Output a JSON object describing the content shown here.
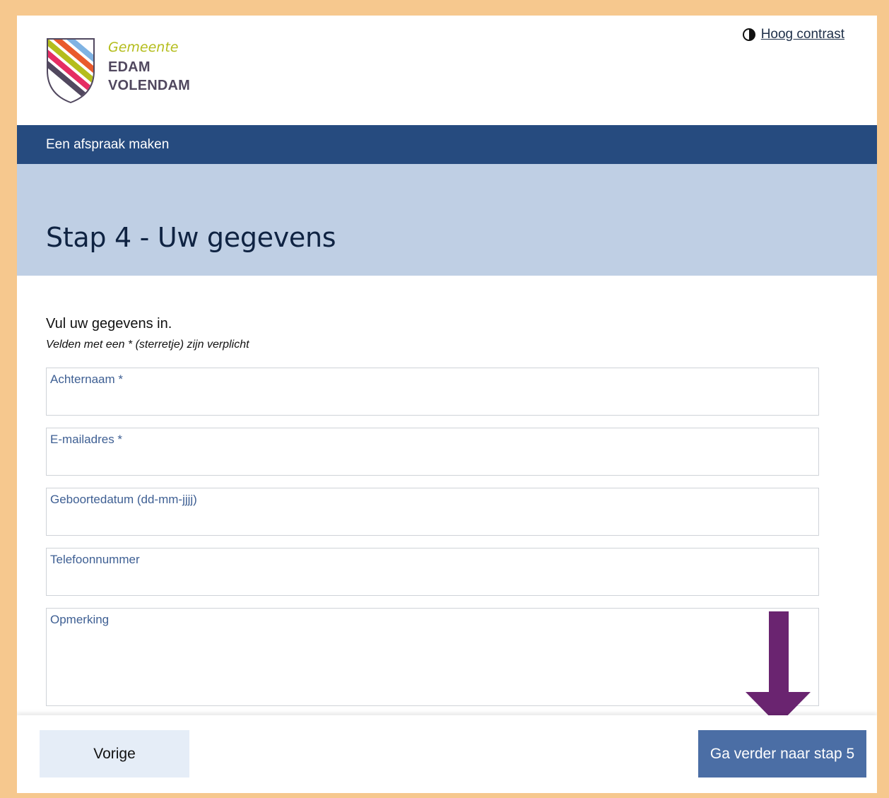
{
  "header": {
    "logo": {
      "small": "Gemeente",
      "line1": "EDAM",
      "line2": "VOLENDAM",
      "icon": "edam-volendam-shield-icon"
    },
    "contrast_link": "Hoog contrast",
    "contrast_icon": "half-circle-contrast-icon"
  },
  "nav": {
    "title": "Een afspraak maken"
  },
  "hero": {
    "title": "Stap 4 - Uw gegevens"
  },
  "form": {
    "intro": "Vul uw gegevens in.",
    "required_note": "Velden met een * (sterretje) zijn verplicht",
    "fields": [
      {
        "label": "Achternaam *",
        "value": ""
      },
      {
        "label": "E-mailadres *",
        "value": ""
      },
      {
        "label": "Geboortedatum (dd-mm-jjjj)",
        "value": ""
      },
      {
        "label": "Telefoonnummer",
        "value": ""
      },
      {
        "label": "Opmerking",
        "value": ""
      }
    ]
  },
  "footer": {
    "prev": "Vorige",
    "next": "Ga verder naar stap 5"
  },
  "annotation": {
    "icon": "down-arrow-icon"
  },
  "colors": {
    "border_frame": "#f6c88e",
    "navy": "#264b7f",
    "hero_bg": "#bfcfe4",
    "label_blue": "#3e5f93",
    "next_btn": "#4b6ea5",
    "prev_btn": "#e5edf7",
    "arrow_purple": "#6a2470"
  }
}
